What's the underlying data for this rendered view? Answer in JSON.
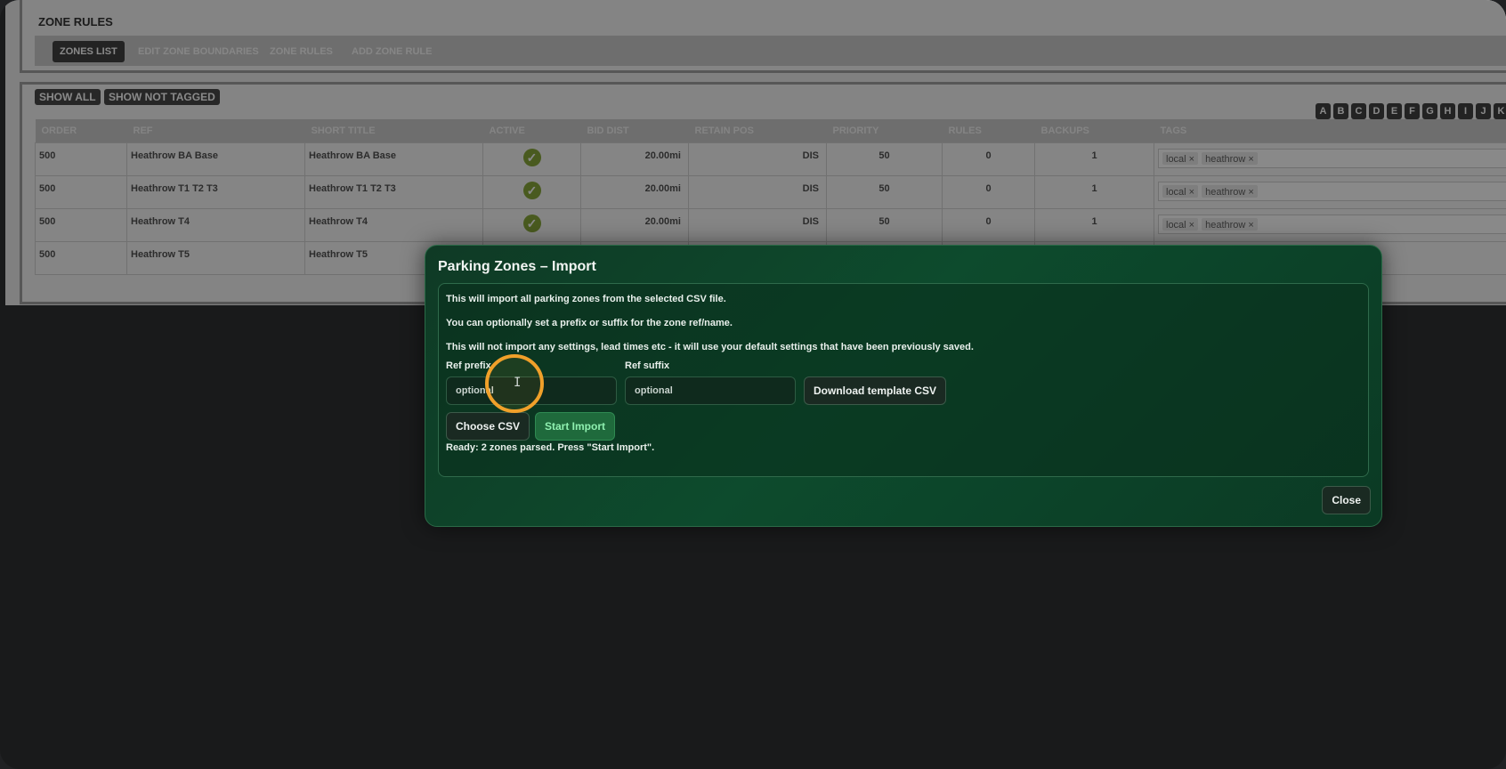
{
  "page": {
    "title": "ZONE RULES",
    "tabs": [
      {
        "label": "ZONES LIST",
        "active": true
      },
      {
        "label": "EDIT ZONE BOUNDARIES",
        "active": false
      },
      {
        "label": "ZONE RULES",
        "active": false
      },
      {
        "label": "ADD ZONE RULE",
        "active": false
      }
    ]
  },
  "filters": {
    "show_all": "SHOW ALL",
    "show_not_tagged": "SHOW NOT TAGGED",
    "alphabet": [
      "A",
      "B",
      "C",
      "D",
      "E",
      "F",
      "G",
      "H",
      "I",
      "J",
      "K"
    ]
  },
  "table": {
    "columns": [
      "ORDER",
      "REF",
      "SHORT TITLE",
      "ACTIVE",
      "BID DIST",
      "RETAIN POS",
      "PRIORITY",
      "RULES",
      "BACKUPS",
      "TAGS"
    ],
    "rows": [
      {
        "order": "500",
        "ref": "Heathrow BA Base",
        "short_title": "Heathrow BA Base",
        "active": true,
        "bid_dist": "20.00mi",
        "retain_pos": "DIS",
        "priority": "50",
        "rules": "0",
        "backups": "1",
        "tags": [
          "local ×",
          "heathrow ×"
        ]
      },
      {
        "order": "500",
        "ref": "Heathrow T1 T2 T3",
        "short_title": "Heathrow T1 T2 T3",
        "active": true,
        "bid_dist": "20.00mi",
        "retain_pos": "DIS",
        "priority": "50",
        "rules": "0",
        "backups": "1",
        "tags": [
          "local ×",
          "heathrow ×"
        ]
      },
      {
        "order": "500",
        "ref": "Heathrow T4",
        "short_title": "Heathrow T4",
        "active": true,
        "bid_dist": "20.00mi",
        "retain_pos": "DIS",
        "priority": "50",
        "rules": "0",
        "backups": "1",
        "tags": [
          "local ×",
          "heathrow ×"
        ]
      },
      {
        "order": "500",
        "ref": "Heathrow T5",
        "short_title": "Heathrow T5",
        "active": false,
        "bid_dist": "",
        "retain_pos": "",
        "priority": "",
        "rules": "",
        "backups": "",
        "tags": []
      }
    ]
  },
  "modal": {
    "title": "Parking Zones – Import",
    "line1": "This will import all parking zones from the selected CSV file.",
    "line2": "You can optionally set a prefix or suffix for the zone ref/name.",
    "line3": "This will not import any settings, lead times etc - it will use your default settings that have been previously saved.",
    "prefix_label": "Ref prefix",
    "prefix_placeholder": "optional",
    "suffix_label": "Ref suffix",
    "suffix_placeholder": "optional",
    "download_template": "Download template CSV",
    "choose_csv": "Choose CSV",
    "start_import": "Start Import",
    "status": "Ready: 2 zones parsed. Press \"Start Import\".",
    "close": "Close"
  },
  "colors": {
    "accent_ring": "#f0a02a",
    "modal_bg": "#0d4b2d",
    "primary_button": "#1f6a3c",
    "active_check": "#7fa12b"
  }
}
